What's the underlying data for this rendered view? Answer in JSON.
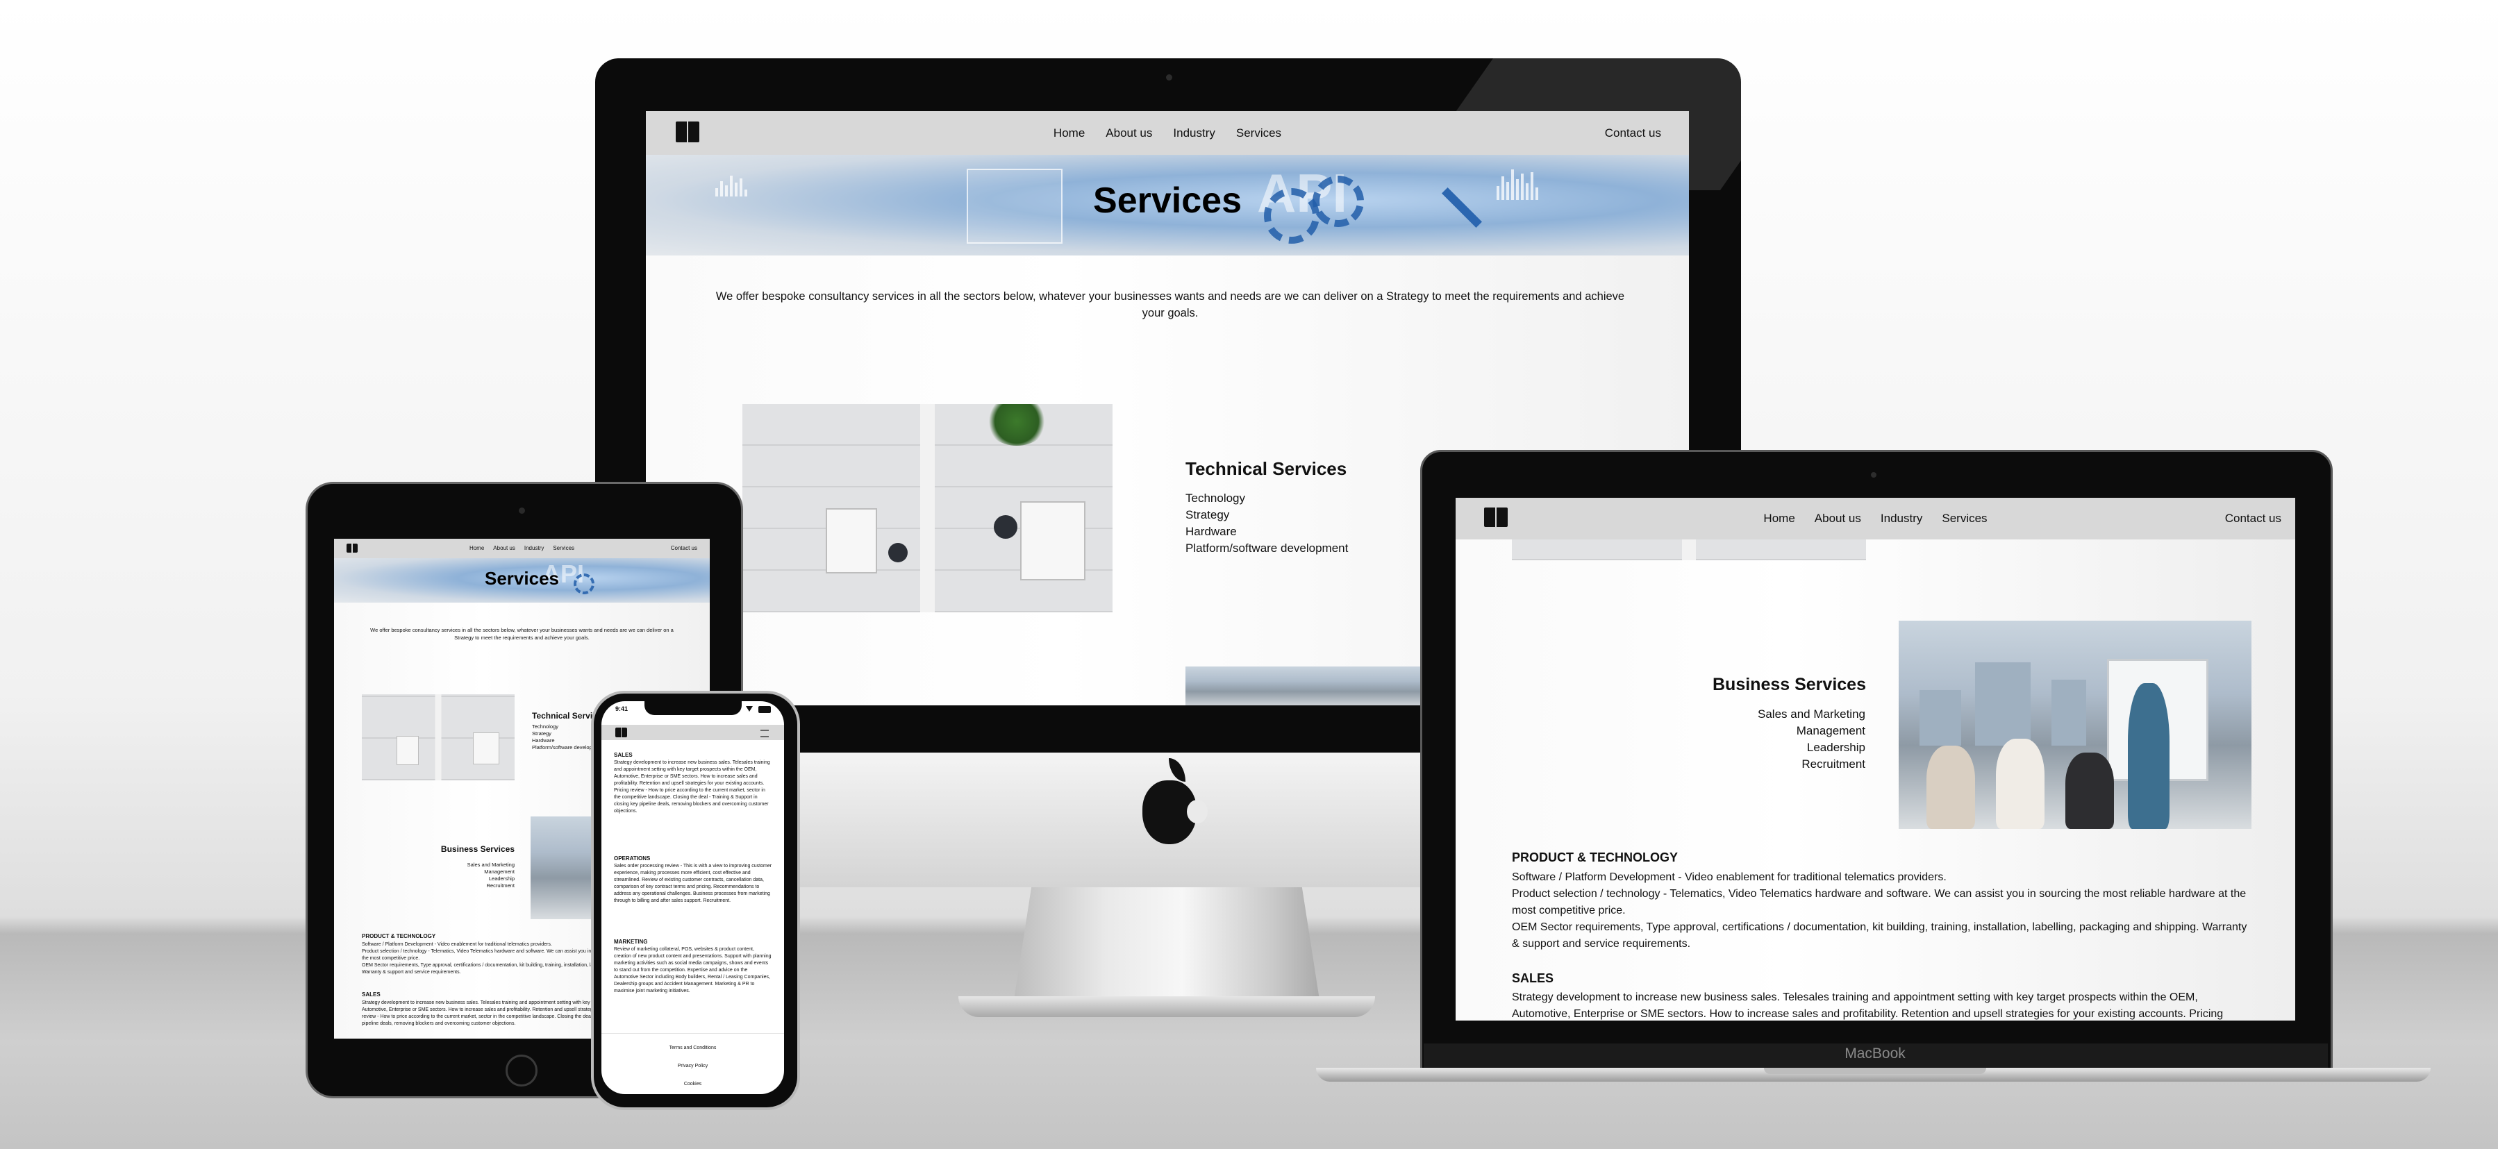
{
  "site": {
    "nav": {
      "items": [
        "Home",
        "About us",
        "Industry",
        "Services"
      ],
      "contact": "Contact us"
    },
    "hero": {
      "title": "Services",
      "ghost_text": "API"
    },
    "intro": "We offer bespoke consultancy services in all the sectors below, whatever your businesses wants and needs are we can deliver on a Strategy to meet the requirements and achieve your goals.",
    "technical": {
      "title": "Technical Services",
      "items": [
        "Technology",
        "Strategy",
        "Hardware",
        "Platform/software development"
      ]
    },
    "business": {
      "title": "Business Services",
      "items": [
        "Sales and Marketing",
        "Management",
        "Leadership",
        "Recruitment"
      ]
    },
    "product_tech": {
      "title": "PRODUCT & TECHNOLOGY",
      "lines": [
        "Software / Platform Development - Video enablement for traditional telematics providers.",
        "Product selection / technology - Telematics, Video Telematics hardware and software. We can assist you in sourcing the most reliable hardware at the most competitive price.",
        "OEM Sector requirements, Type approval, certifications / documentation, kit building, training, installation, labelling, packaging and shipping. Warranty & support and service requirements."
      ]
    },
    "sales": {
      "title": "SALES",
      "text": "Strategy development to increase new business sales. Telesales training and appointment setting with key target prospects within the OEM, Automotive, Enterprise or SME sectors. How to increase sales and profitability. Retention and upsell strategies for your existing accounts. Pricing review - How to price according to the current market, sector in the competitive landscape. Closing the deal - Training & Support in closing key pipeline deals, removing blockers and overcoming customer objections."
    },
    "operations": {
      "title": "OPERATIONS",
      "text": "Sales order processing review - This is with a view to improving customer experience, making processes more efficient, cost effective and streamlined. Review of existing customer contracts, cancellation data, comparison of key contract terms and pricing. Recommendations to address any operational challenges. Business processes from marketing through to billing and after sales support. Recruitment."
    },
    "marketing": {
      "title": "MARKETING",
      "text": "Review of marketing collateral, POS, websites & product content, creation of new product content and presentations. Support with planning marketing activities such as social media campaigns, shows and events to stand out from the competition. Expertise and advice on the Automotive Sector including Body builders, Rental / Leasing Companies, Dealership groups and Accident Management. Marketing & PR to maximise joint marketing initiatives."
    },
    "footer": {
      "links": [
        "Terms and Conditions",
        "Privacy Policy",
        "Cookies"
      ]
    }
  },
  "devices": {
    "phone_time": "9:41",
    "laptop_brand": "MacBook"
  },
  "colors": {
    "nav_bg": "#d8d8d8",
    "bezel": "#0b0b0b",
    "hero_blue": "#8fb2d8",
    "text": "#111111"
  }
}
